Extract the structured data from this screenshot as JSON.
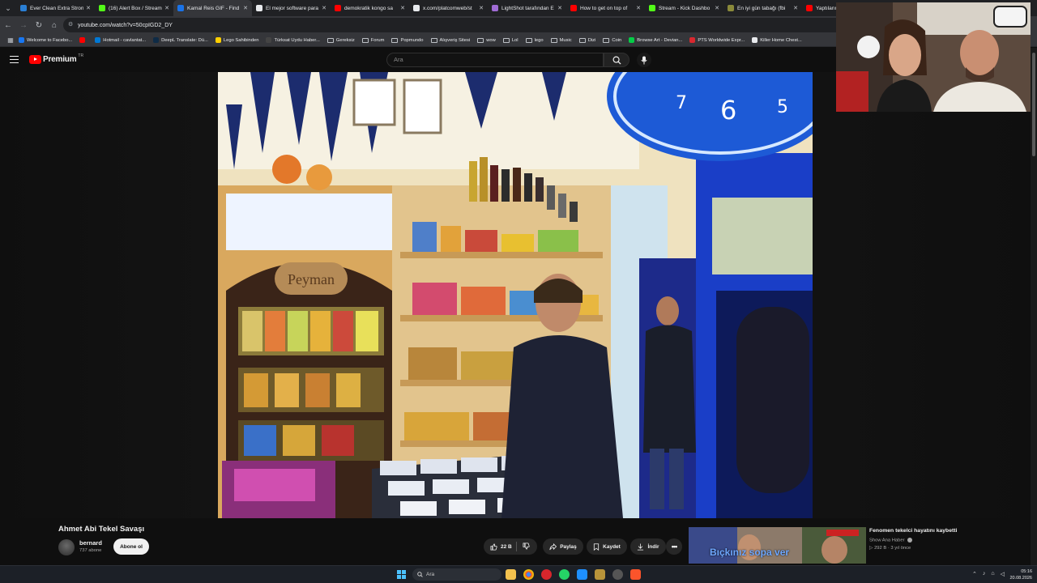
{
  "browser": {
    "tabs": [
      {
        "label": "Ever Clean Extra Strong",
        "color": "#2a7fd4",
        "active": false
      },
      {
        "label": "(16) Alert Box / Stream",
        "color": "#53fc18",
        "active": false
      },
      {
        "label": "Kamal Reis GIF - Find &",
        "color": "#1a73e8",
        "active": true
      },
      {
        "label": "El mejor software para",
        "color": "#e8eaed",
        "active": false
      },
      {
        "label": "demokratik kongo sa",
        "color": "#ff0000",
        "active": false
      },
      {
        "label": "x.com/platcomweb/st",
        "color": "#e8eaed",
        "active": false
      },
      {
        "label": "LightShot tarafından E",
        "color": "#a06cd5",
        "active": false
      },
      {
        "label": "How to get on top of",
        "color": "#ff0000",
        "active": false
      },
      {
        "label": "Stream - Kick Dashbo",
        "color": "#53fc18",
        "active": false
      },
      {
        "label": "En iyi gün tabağı (fbi",
        "color": "#8a8a3a",
        "active": false
      },
      {
        "label": "Yaptılarım evle",
        "color": "#ff0000",
        "active": false
      }
    ],
    "address": "youtube.com/watch?v=50cpIGD2_DY",
    "bookmarks": [
      {
        "label": "Welcome to Facebo...",
        "type": "site",
        "color": "#1877f2"
      },
      {
        "label": "",
        "type": "site",
        "color": "#ff0000"
      },
      {
        "label": "Hotmail - cavlantat...",
        "type": "site",
        "color": "#0078d4"
      },
      {
        "label": "DeepL Translate: Dü...",
        "type": "site",
        "color": "#0f2b46"
      },
      {
        "label": "Lego Sahibinden",
        "type": "site",
        "color": "#ffcf00"
      },
      {
        "label": "Türksat Uydu Haber...",
        "type": "site",
        "color": "#444"
      },
      {
        "label": "Gereksiz",
        "type": "folder"
      },
      {
        "label": "Forum",
        "type": "folder"
      },
      {
        "label": "Popmundo",
        "type": "folder"
      },
      {
        "label": "Alışveriş Sitesi",
        "type": "folder"
      },
      {
        "label": "wow",
        "type": "folder"
      },
      {
        "label": "Lol",
        "type": "folder"
      },
      {
        "label": "lego",
        "type": "folder"
      },
      {
        "label": "Music",
        "type": "folder"
      },
      {
        "label": "Dizi",
        "type": "folder"
      },
      {
        "label": "Coin",
        "type": "folder"
      },
      {
        "label": "Browse Art - Devian...",
        "type": "site",
        "color": "#05cc47"
      },
      {
        "label": "PTS Worldwide Expr...",
        "type": "site",
        "color": "#d8282f"
      },
      {
        "label": "Killer Home Chest...",
        "type": "site",
        "color": "#e8eaed"
      }
    ]
  },
  "youtube": {
    "brand": "Premium",
    "country": "TR",
    "search_placeholder": "Ara",
    "video_title": "Ahmet Abi Tekel Savaşı",
    "channel": {
      "name": "bernard",
      "subs": "737 abone"
    },
    "subscribe_label": "Abone ol",
    "likes": "22 B",
    "share_label": "Paylaş",
    "save_label": "Kaydet",
    "download_label": "İndir",
    "recommendation": {
      "title": "Fenomen tekelci hayatını kaybetti",
      "channel": "Show Ana Haber",
      "meta": "292 B · 3 yıl önce",
      "thumb_caption": "Bıçkınız sopa ver"
    }
  },
  "video_scene": {
    "shop_sign": "Peyman",
    "clock_numbers": [
      "7",
      "6",
      "5"
    ]
  },
  "taskbar": {
    "search_placeholder": "Ara",
    "time": "05:16",
    "date": "20.08.2026"
  }
}
